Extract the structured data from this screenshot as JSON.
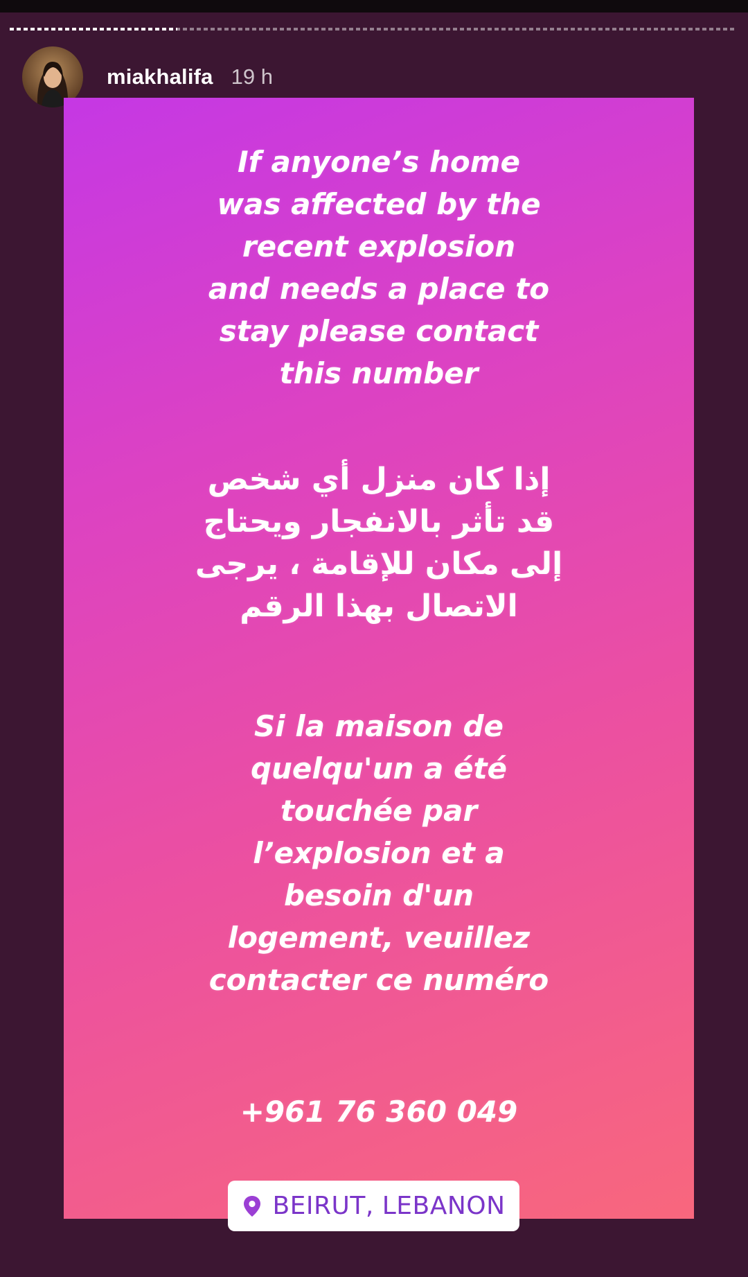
{
  "story": {
    "progress_fraction": 0.23,
    "username": "miakhalifa",
    "time_ago": "19 h",
    "english_lines": [
      "If anyone’s home",
      "was affected by the",
      "recent explosion",
      "and needs a place to",
      "stay please contact",
      "this number"
    ],
    "arabic_lines": [
      "إذا كان منزل أي شخص",
      "قد تأثر بالانفجار ويحتاج",
      "إلى مكان للإقامة ، يرجى",
      "الاتصال بهذا الرقم"
    ],
    "french_lines": [
      "Si la maison de",
      "quelqu'un a été",
      "touchée par",
      "l’explosion et a",
      "besoin d'un",
      "logement, veuillez",
      "contacter ce numéro"
    ],
    "phone": "+961 76 360 049",
    "location_sticker": "BEIRUT, LEBANON"
  },
  "colors": {
    "background": "#3c1632",
    "gradient_top": "#c538e4",
    "gradient_bottom": "#f8677d",
    "location_text": "#7b35c9"
  },
  "icons": {
    "location": "map-pin-icon"
  }
}
